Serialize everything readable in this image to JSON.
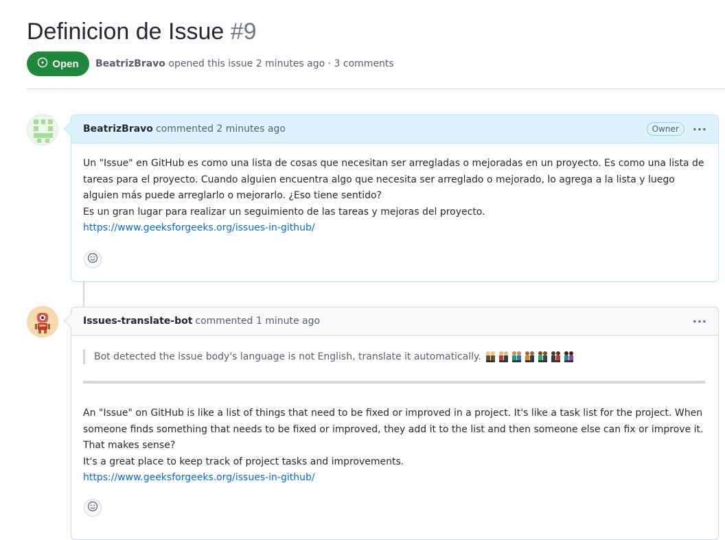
{
  "issue": {
    "title": "Definicion de Issue",
    "number": "#9",
    "state": "Open",
    "author": "BeatrizBravo",
    "meta_text": "opened this issue 2 minutes ago · 3 comments"
  },
  "comments": [
    {
      "author": "BeatrizBravo",
      "action": "commented 2 minutes ago",
      "badge": "Owner",
      "paragraph": "Un \"Issue\" en GitHub es como una lista de cosas que necesitan ser arregladas o mejoradas en un proyecto. Es como una lista de tareas para el proyecto. Cuando alguien encuentra algo que necesita ser arreglado o mejorado, lo agrega a la lista y luego alguien más puede arreglarlo o mejorarlo. ¿Eso tiene sentido?",
      "line2": "Es un gran lugar para realizar un seguimiento de las tareas y mejoras del proyecto.",
      "link": "https://www.geeksforgeeks.org/issues-in-github/"
    },
    {
      "author": "Issues-translate-bot",
      "action": "commented 1 minute ago",
      "quote": "Bot detected the issue body's language is not English, translate it automatically.",
      "paragraph": "An \"Issue\" on GitHub is like a list of things that need to be fixed or improved in a project. It's like a task list for the project. When someone finds something that needs to be fixed or improved, they add it to the list and then someone else can fix or improve it. That makes sense?",
      "line2": "It's a great place to keep track of project tasks and improvements.",
      "link": "https://www.geeksforgeeks.org/issues-in-github/"
    }
  ],
  "icons": {
    "state": "issue-opened-icon",
    "more": "kebab-horizontal-icon",
    "reaction": "smiley-icon",
    "people": "people-holding-hands-icon"
  },
  "colors": {
    "open_green": "#1f883d",
    "link_blue": "#0969da",
    "owner_header": "#ddf4ff",
    "border": "#d0d7de"
  },
  "more_label": "···"
}
